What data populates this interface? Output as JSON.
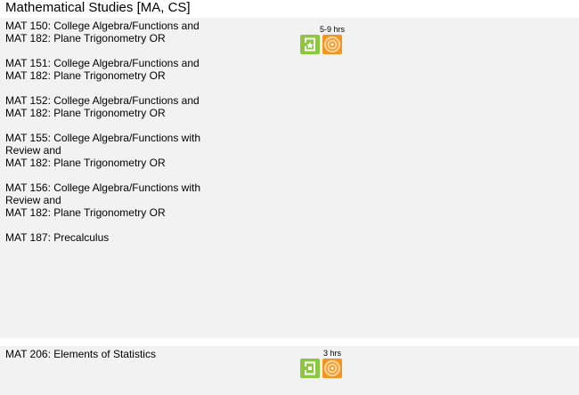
{
  "header": {
    "title": "Mathematical Studies [MA, CS]"
  },
  "sections": [
    {
      "hours": "5-9 hrs",
      "courses": [
        {
          "lines": [
            "MAT 150: College Algebra/Functions and",
            "MAT 182: Plane Trigonometry OR"
          ]
        },
        {
          "lines": [
            "MAT 151: College Algebra/Functions and",
            "MAT 182: Plane Trigonometry OR"
          ]
        },
        {
          "lines": [
            "MAT 152: College Algebra/Functions and",
            "MAT 182: Plane Trigonometry OR"
          ]
        },
        {
          "lines": [
            "MAT 155: College Algebra/Functions with",
            "Review and",
            "MAT 182: Plane Trigonometry OR"
          ]
        },
        {
          "lines": [
            "MAT 156: College Algebra/Functions with",
            "Review and",
            "MAT 182: Plane Trigonometry OR"
          ]
        },
        {
          "lines": [
            "MAT 187: Precalculus"
          ]
        }
      ],
      "icons": [
        {
          "name": "transfer-star-icon",
          "color": "#8dc63f"
        },
        {
          "name": "orange-target-icon",
          "color": "#f7941d"
        }
      ]
    },
    {
      "hours": "3 hrs",
      "courses": [
        {
          "lines": [
            "MAT 206: Elements of Statistics"
          ]
        }
      ],
      "icons": [
        {
          "name": "transfer-icon",
          "color": "#8dc63f"
        },
        {
          "name": "orange-target-icon",
          "color": "#f7941d"
        }
      ]
    }
  ]
}
